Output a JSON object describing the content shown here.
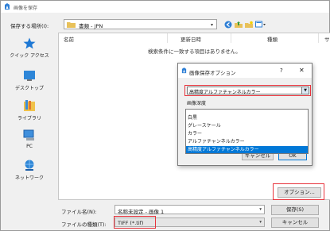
{
  "window": {
    "title": "画像を保存"
  },
  "location": {
    "label": "保存する場所(I):",
    "value": "書類 - JPN"
  },
  "places": [
    {
      "label": "クイック アクセス",
      "icon": "star-icon"
    },
    {
      "label": "デスクトップ",
      "icon": "desktop-icon"
    },
    {
      "label": "ライブラリ",
      "icon": "library-icon"
    },
    {
      "label": "PC",
      "icon": "computer-icon"
    },
    {
      "label": "ネットワーク",
      "icon": "network-icon"
    }
  ],
  "filelist": {
    "columns": [
      "名前",
      "更新日時",
      "種類",
      "サ"
    ],
    "empty_message": "検索条件に一致する項目はありません。"
  },
  "filename": {
    "label": "ファイル名(N):",
    "value": "名称未設定 - 画像 1"
  },
  "filetype": {
    "label": "ファイルの種類(T):",
    "value": "TIFF (*.tif)"
  },
  "buttons": {
    "save": "保存(S)",
    "cancel": "キャンセル",
    "options": "オプション..."
  },
  "options_dialog": {
    "title": "画像保存オプション",
    "help": "?",
    "close": "✕",
    "selected_value": "高精度アルファチャンネルカラー",
    "field_label": "画像深度",
    "cancel": "キャンセル",
    "ok": "OK",
    "options": [
      "白黒",
      "グレースケール",
      "カラー",
      "アルファチャンネルカラー",
      "高精度アルファチャンネルカラー"
    ],
    "selected_index": 4
  },
  "colors": {
    "highlight": "#e8333c",
    "selection": "#0078d7"
  }
}
